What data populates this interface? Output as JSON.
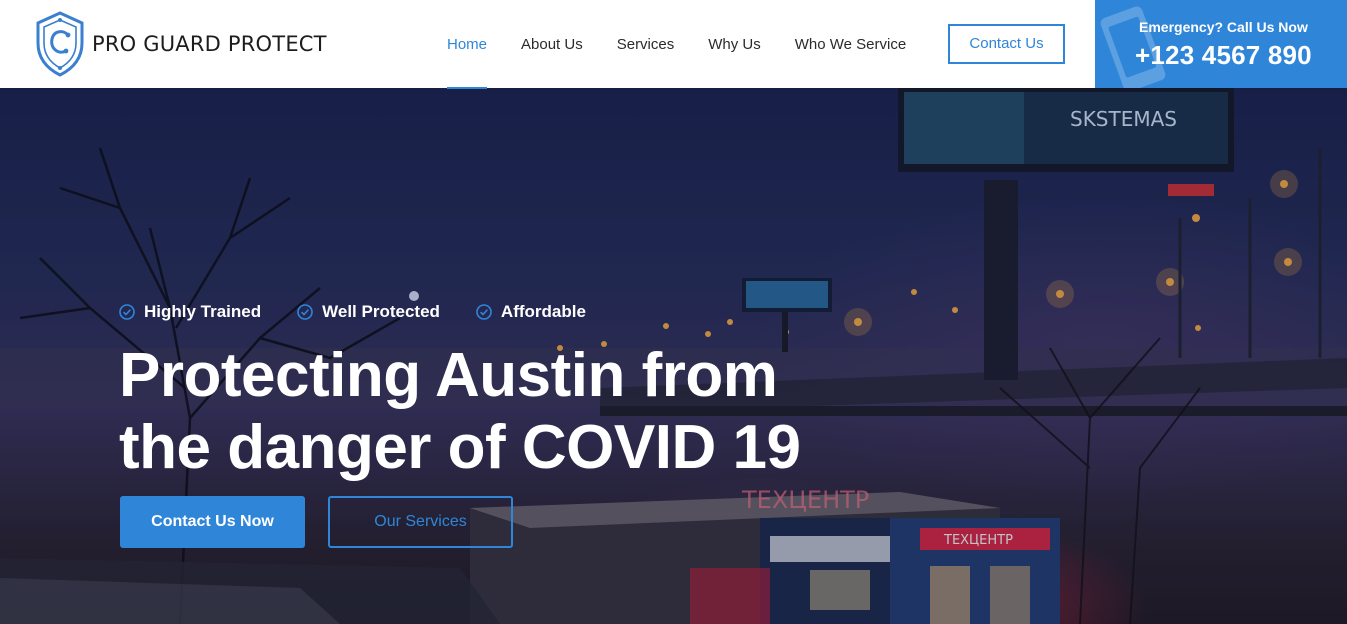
{
  "brand": {
    "name": "PRO GUARD PROTECT",
    "logo_icon": "shield-logo-icon",
    "accent_color": "#2f86d9"
  },
  "nav": {
    "items": [
      {
        "label": "Home",
        "active": true
      },
      {
        "label": "About Us",
        "active": false
      },
      {
        "label": "Services",
        "active": false
      },
      {
        "label": "Why Us",
        "active": false
      },
      {
        "label": "Who We Service",
        "active": false
      }
    ],
    "contact_button": "Contact Us"
  },
  "emergency": {
    "label": "Emergency? Call Us Now",
    "phone": "+123 4567 890",
    "icon": "phone-icon"
  },
  "hero": {
    "features": [
      {
        "label": "Highly Trained",
        "icon": "check-circle-icon"
      },
      {
        "label": "Well Protected",
        "icon": "check-circle-icon"
      },
      {
        "label": "Affordable",
        "icon": "check-circle-icon"
      }
    ],
    "title_line1": "Protecting Austin from",
    "title_line2": "the danger of COVID 19",
    "primary_button": "Contact Us Now",
    "secondary_button": "Our Services",
    "background": "night-city-street-photo"
  }
}
